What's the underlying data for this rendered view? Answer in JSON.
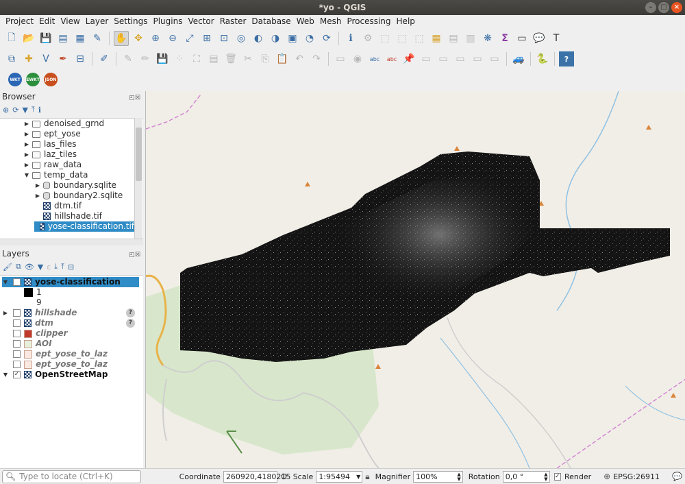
{
  "window": {
    "title": "*yo - QGIS"
  },
  "menu": [
    "Project",
    "Edit",
    "View",
    "Layer",
    "Settings",
    "Plugins",
    "Vector",
    "Raster",
    "Database",
    "Web",
    "Mesh",
    "Processing",
    "Help"
  ],
  "badges": [
    {
      "label": "WKT",
      "color": "#2b67b4"
    },
    {
      "label": "EWKT",
      "color": "#2c8f3c"
    },
    {
      "label": "JSON",
      "color": "#c8501e"
    }
  ],
  "browser": {
    "title": "Browser",
    "items": [
      {
        "label": "denoised_grnd",
        "kind": "folder",
        "level": 1,
        "arrow": "▶"
      },
      {
        "label": "ept_yose",
        "kind": "folder",
        "level": 1,
        "arrow": "▶"
      },
      {
        "label": "las_files",
        "kind": "folder",
        "level": 1,
        "arrow": "▶"
      },
      {
        "label": "laz_tiles",
        "kind": "folder",
        "level": 1,
        "arrow": "▶"
      },
      {
        "label": "raw_data",
        "kind": "folder",
        "level": 1,
        "arrow": "▶"
      },
      {
        "label": "temp_data",
        "kind": "folder",
        "level": 1,
        "arrow": "▼"
      },
      {
        "label": "boundary.sqlite",
        "kind": "db",
        "level": 2,
        "arrow": "▶"
      },
      {
        "label": "boundary2.sqlite",
        "kind": "db",
        "level": 2,
        "arrow": "▶"
      },
      {
        "label": "dtm.tif",
        "kind": "raster",
        "level": 2,
        "arrow": ""
      },
      {
        "label": "hillshade.tif",
        "kind": "raster",
        "level": 2,
        "arrow": ""
      },
      {
        "label": "yose-classification.tif",
        "kind": "raster",
        "level": 2,
        "arrow": "",
        "selected": true
      }
    ]
  },
  "layers": {
    "title": "Layers",
    "items": [
      {
        "label": "yose-classification",
        "checked": true,
        "visible": true,
        "selected": true,
        "icon": "raster",
        "arrow": "▼"
      },
      {
        "label": "1",
        "legend": true,
        "swatch": "#000000"
      },
      {
        "label": "9",
        "legend": true,
        "swatch": "#ffffff"
      },
      {
        "label": "hillshade",
        "checked": false,
        "icon": "raster",
        "arrow": "▶",
        "unknown": true
      },
      {
        "label": "dtm",
        "checked": false,
        "icon": "raster",
        "arrow": "",
        "unknown": true
      },
      {
        "label": "clipper",
        "checked": false,
        "icon": "fill",
        "fill": "#c0392b",
        "arrow": ""
      },
      {
        "label": "AOI",
        "checked": false,
        "icon": "fill",
        "fill": "#e6f0dc",
        "arrow": ""
      },
      {
        "label": "ept_yose_to_laz",
        "checked": false,
        "icon": "fill",
        "fill": "#fbe9e1",
        "arrow": ""
      },
      {
        "label": "ept_yose_to_laz",
        "checked": false,
        "icon": "fill",
        "fill": "#fbe9e1",
        "arrow": ""
      },
      {
        "label": "OpenStreetMap",
        "checked": true,
        "visible": true,
        "icon": "raster",
        "arrow": "▼"
      }
    ]
  },
  "status": {
    "locator_placeholder": "Type to locate (Ctrl+K)",
    "coordinate_label": "Coordinate",
    "coordinate_value": "260920,4180215",
    "scale_label": "Scale",
    "scale_value": "1:95494",
    "magnifier_label": "Magnifier",
    "magnifier_value": "100%",
    "rotation_label": "Rotation",
    "rotation_value": "0,0 °",
    "render_label": "Render",
    "render_checked": true,
    "crs": "EPSG:26911"
  }
}
